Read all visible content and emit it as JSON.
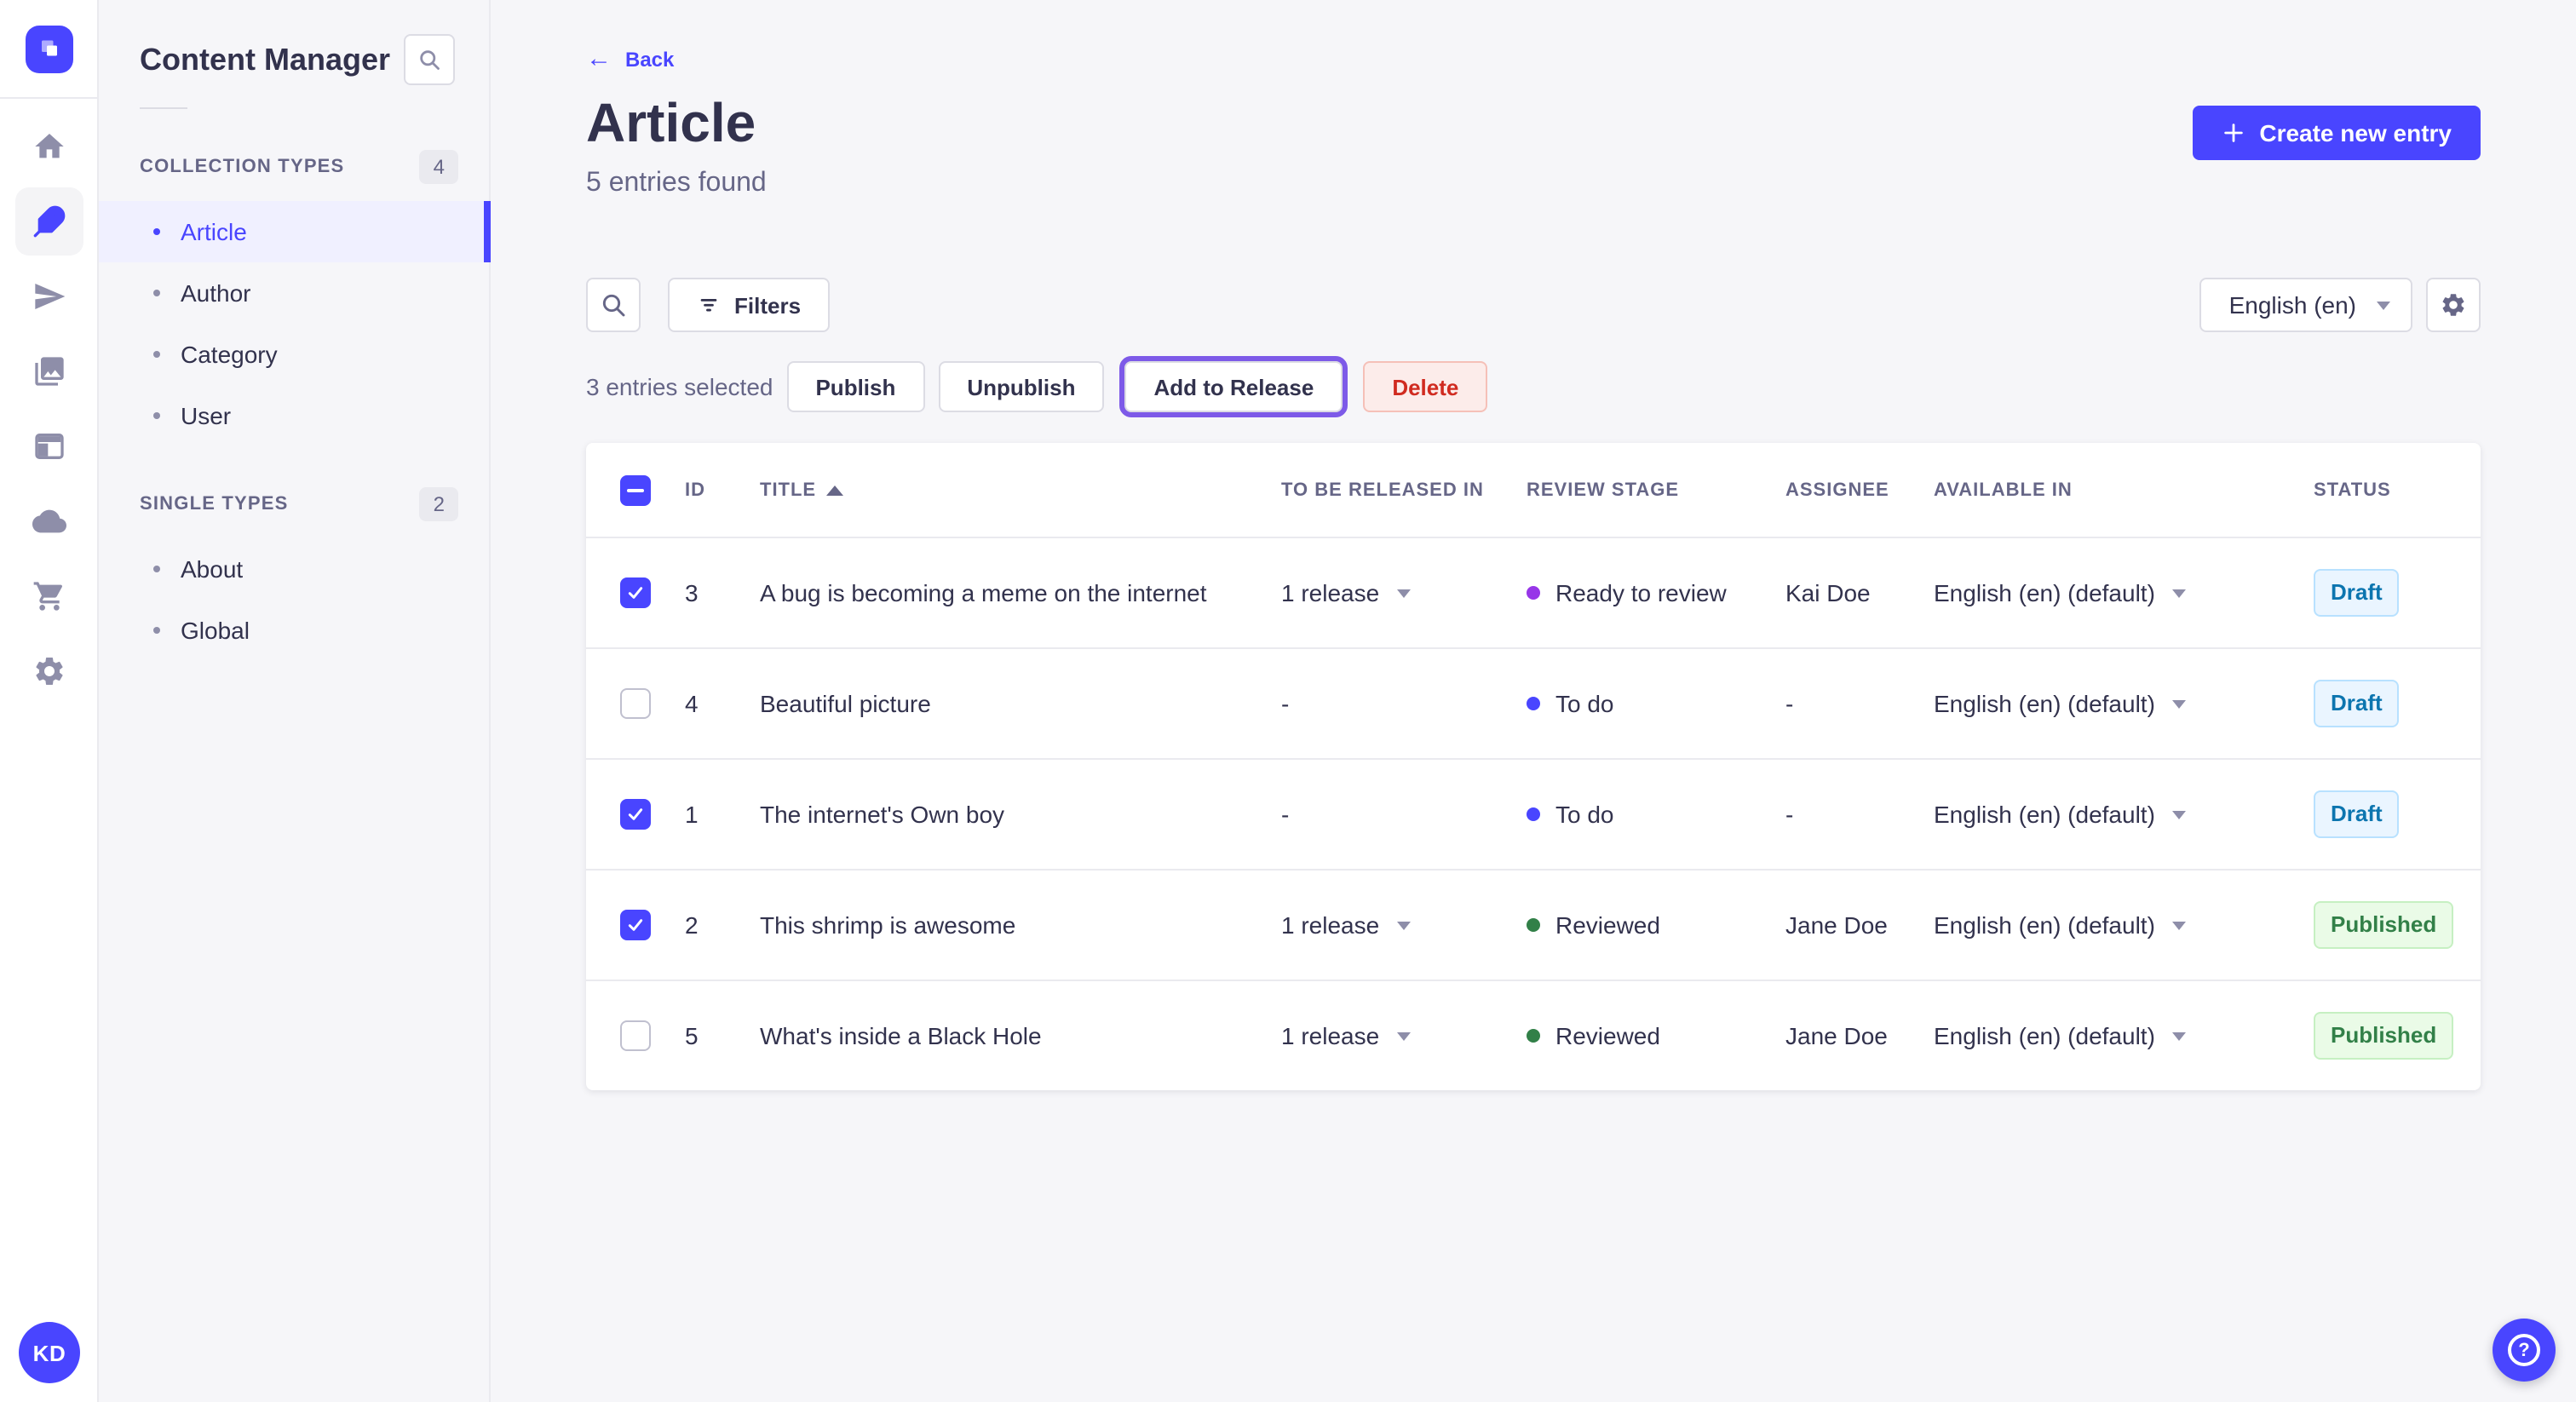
{
  "colors": {
    "primary": "#4945ff",
    "active_item_bg": "#f0f0ff",
    "release_focus_ring": "#7d5ae8",
    "danger_text": "#d02b20",
    "danger_bg": "#fcecea",
    "stage_todo_dot": "#4945ff",
    "stage_ready_to_review_dot": "#9736e8",
    "stage_reviewed_dot": "#328048",
    "draft_badge_text": "#0c75af",
    "published_badge_text": "#328048"
  },
  "rail": {
    "avatar_initials": "KD",
    "icons": [
      "strapi-logo",
      "home",
      "feather-content-manager",
      "paper-plane",
      "images-media-library",
      "layout",
      "cloud",
      "shopping-cart",
      "gear-settings",
      "help-question-mark"
    ]
  },
  "sidebar": {
    "title": "Content Manager",
    "sections": [
      {
        "label": "COLLECTION TYPES",
        "count": "4",
        "items": [
          {
            "label": "Article",
            "active": true
          },
          {
            "label": "Author",
            "active": false
          },
          {
            "label": "Category",
            "active": false
          },
          {
            "label": "User",
            "active": false
          }
        ]
      },
      {
        "label": "SINGLE TYPES",
        "count": "2",
        "items": [
          {
            "label": "About",
            "active": false
          },
          {
            "label": "Global",
            "active": false
          }
        ]
      }
    ]
  },
  "header": {
    "back_label": "Back",
    "title": "Article",
    "subtitle": "5 entries found",
    "create_button_label": "Create new entry"
  },
  "toolbar": {
    "filters_label": "Filters",
    "locale_value": "English (en)"
  },
  "selection_bar": {
    "summary": "3 entries selected",
    "publish_label": "Publish",
    "unpublish_label": "Unpublish",
    "add_to_release_label": "Add to Release",
    "delete_label": "Delete"
  },
  "table": {
    "columns": [
      "ID",
      "TITLE",
      "TO BE RELEASED IN",
      "REVIEW STAGE",
      "ASSIGNEE",
      "AVAILABLE IN",
      "STATUS"
    ],
    "sorted_column": "TITLE",
    "sort_direction": "asc",
    "select_all_state": "indeterminate",
    "rows": [
      {
        "selected": true,
        "id": "3",
        "title": "A bug is becoming a meme on the internet",
        "release": "1 release",
        "has_release_menu": true,
        "stage": "Ready to review",
        "stage_color": "#9736e8",
        "assignee": "Kai Doe",
        "locale": "English (en) (default)",
        "status": "Draft"
      },
      {
        "selected": false,
        "id": "4",
        "title": "Beautiful picture",
        "release": "-",
        "has_release_menu": false,
        "stage": "To do",
        "stage_color": "#4945ff",
        "assignee": "-",
        "locale": "English (en) (default)",
        "status": "Draft"
      },
      {
        "selected": true,
        "id": "1",
        "title": "The internet's Own boy",
        "release": "-",
        "has_release_menu": false,
        "stage": "To do",
        "stage_color": "#4945ff",
        "assignee": "-",
        "locale": "English (en) (default)",
        "status": "Draft"
      },
      {
        "selected": true,
        "id": "2",
        "title": "This shrimp is awesome",
        "release": "1 release",
        "has_release_menu": true,
        "stage": "Reviewed",
        "stage_color": "#328048",
        "assignee": "Jane Doe",
        "locale": "English (en) (default)",
        "status": "Published"
      },
      {
        "selected": false,
        "id": "5",
        "title": "What's inside a Black Hole",
        "release": "1 release",
        "has_release_menu": true,
        "stage": "Reviewed",
        "stage_color": "#328048",
        "assignee": "Jane Doe",
        "locale": "English (en) (default)",
        "status": "Published"
      }
    ]
  }
}
